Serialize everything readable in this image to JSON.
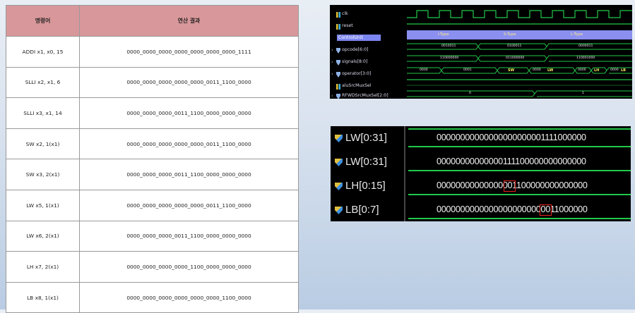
{
  "table": {
    "headers": [
      "명령어",
      "연산 결과"
    ],
    "rows": [
      {
        "instr": "ADDI x1, x0, 15",
        "result": "0000_0000_0000_0000_0000_0000_0000_1111"
      },
      {
        "instr": "SLLI x2, x1, 6",
        "result": "0000_0000_0000_0000_0000_0011_1100_0000"
      },
      {
        "instr": "SLLI x3, x1, 14",
        "result": "0000_0000_0000_0011_1100_0000_0000_0000"
      },
      {
        "instr": "SW x2, 1(x1)",
        "result": "0000_0000_0000_0000_0000_0011_1100_0000"
      },
      {
        "instr": "SW x3, 2(x1)",
        "result": "0000_0000_0000_0011_1100_0000_0000_0000"
      },
      {
        "instr": "LW x5, 1(x1)",
        "result": "0000_0000_0000_0000_0000_0011_1100_0000"
      },
      {
        "instr": "LW x6, 2(x1)",
        "result": "0000_0000_0000_0011_1100_0000_0000_0000"
      },
      {
        "instr": "LH x7, 2(x1)",
        "result": "0000_0000_0000_0000_1100_0000_0000_0000"
      },
      {
        "instr": "LB x8, 1(x1)",
        "result": "0000_0000_0000_0000_0000_0000_1100_0000"
      }
    ]
  },
  "wave1": {
    "signals": [
      "clk",
      "reset",
      "ControlUnit",
      "opcode[6:0]",
      "signals[8:0]",
      "operator[3:0]",
      "aluSrcMuxSel",
      "RFWDSrcMuxSel[2:0]"
    ],
    "control_labels": [
      "I-Type",
      "S-Type",
      "L-Type"
    ],
    "opcode_vals": [
      "0010011",
      "0100011",
      "0000011"
    ],
    "signals_vals": [
      "110000000",
      "011000000",
      "110001000"
    ],
    "operator_vals": [
      "0000",
      "0001",
      "SW",
      "0000",
      "LW",
      "0000",
      "LH",
      "0000",
      "LB"
    ],
    "rfwd_vals": [
      "0",
      "1"
    ]
  },
  "wave2": {
    "signals": [
      {
        "name": "LW[0:31]",
        "value": "00000000000000000000001111000000"
      },
      {
        "name": "LW[0:31]",
        "value": "00000000000000111100000000000000"
      },
      {
        "name": "LH[0:15]",
        "value": "00000000000000001100000000000000"
      },
      {
        "name": "LB[0:7]",
        "value": "00000000000000000000000011000000"
      }
    ]
  },
  "colors": {
    "header_bg": "#d8979a",
    "wave_green": "#22c84a",
    "highlight_box": "#e8231f",
    "control_bar": "#8a8ff0"
  }
}
